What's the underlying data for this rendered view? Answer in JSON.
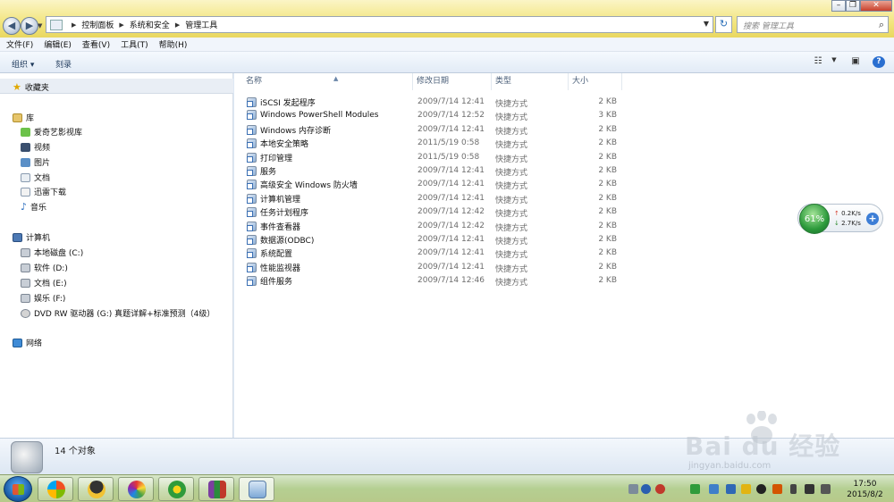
{
  "window": {
    "breadcrumb": [
      "控制面板",
      "系统和安全",
      "管理工具"
    ],
    "search_placeholder": "搜索 管理工具"
  },
  "menu": [
    "文件(F)",
    "编辑(E)",
    "查看(V)",
    "工具(T)",
    "帮助(H)"
  ],
  "toolbar": {
    "organize": "组织",
    "burn": "刻录"
  },
  "nav": {
    "favorites": "收藏夹",
    "libraries": "库",
    "library_items": [
      "爱奇艺影视库",
      "视频",
      "图片",
      "文档",
      "迅雷下载",
      "音乐"
    ],
    "computer": "计算机",
    "drives": [
      "本地磁盘 (C:)",
      "软件 (D:)",
      "文档 (E:)",
      "娱乐 (F:)",
      "DVD RW 驱动器 (G:) 真题详解+标准预测（4级）"
    ],
    "network": "网络"
  },
  "columns": {
    "name": "名称",
    "modified": "修改日期",
    "type": "类型",
    "size": "大小"
  },
  "files": [
    {
      "name": "iSCSI 发起程序",
      "date": "2009/7/14 12:41",
      "type": "快捷方式",
      "size": "2 KB"
    },
    {
      "name": "Windows PowerShell Modules",
      "date": "2009/7/14 12:52",
      "type": "快捷方式",
      "size": "3 KB"
    },
    {
      "name": "Windows 内存诊断",
      "date": "2009/7/14 12:41",
      "type": "快捷方式",
      "size": "2 KB"
    },
    {
      "name": "本地安全策略",
      "date": "2011/5/19 0:58",
      "type": "快捷方式",
      "size": "2 KB"
    },
    {
      "name": "打印管理",
      "date": "2011/5/19 0:58",
      "type": "快捷方式",
      "size": "2 KB"
    },
    {
      "name": "服务",
      "date": "2009/7/14 12:41",
      "type": "快捷方式",
      "size": "2 KB"
    },
    {
      "name": "高级安全 Windows 防火墙",
      "date": "2009/7/14 12:41",
      "type": "快捷方式",
      "size": "2 KB"
    },
    {
      "name": "计算机管理",
      "date": "2009/7/14 12:41",
      "type": "快捷方式",
      "size": "2 KB"
    },
    {
      "name": "任务计划程序",
      "date": "2009/7/14 12:42",
      "type": "快捷方式",
      "size": "2 KB"
    },
    {
      "name": "事件查看器",
      "date": "2009/7/14 12:42",
      "type": "快捷方式",
      "size": "2 KB"
    },
    {
      "name": "数据源(ODBC)",
      "date": "2009/7/14 12:41",
      "type": "快捷方式",
      "size": "2 KB"
    },
    {
      "name": "系统配置",
      "date": "2009/7/14 12:41",
      "type": "快捷方式",
      "size": "2 KB"
    },
    {
      "name": "性能监视器",
      "date": "2009/7/14 12:41",
      "type": "快捷方式",
      "size": "2 KB"
    },
    {
      "name": "组件服务",
      "date": "2009/7/14 12:46",
      "type": "快捷方式",
      "size": "2 KB"
    }
  ],
  "status": {
    "count": "14 个对象"
  },
  "net_widget": {
    "percent": "61%",
    "up": "0.2K/s",
    "down": "2.7K/s"
  },
  "watermark": {
    "brand": "Bai du 经验",
    "url": "jingyan.baidu.com"
  },
  "clock": {
    "time": "17:50",
    "date": "2015/8/2"
  },
  "colors": {
    "titlebar": "#f2e57e",
    "taskbar": "#b5cf92",
    "accent": "#1e395b"
  }
}
